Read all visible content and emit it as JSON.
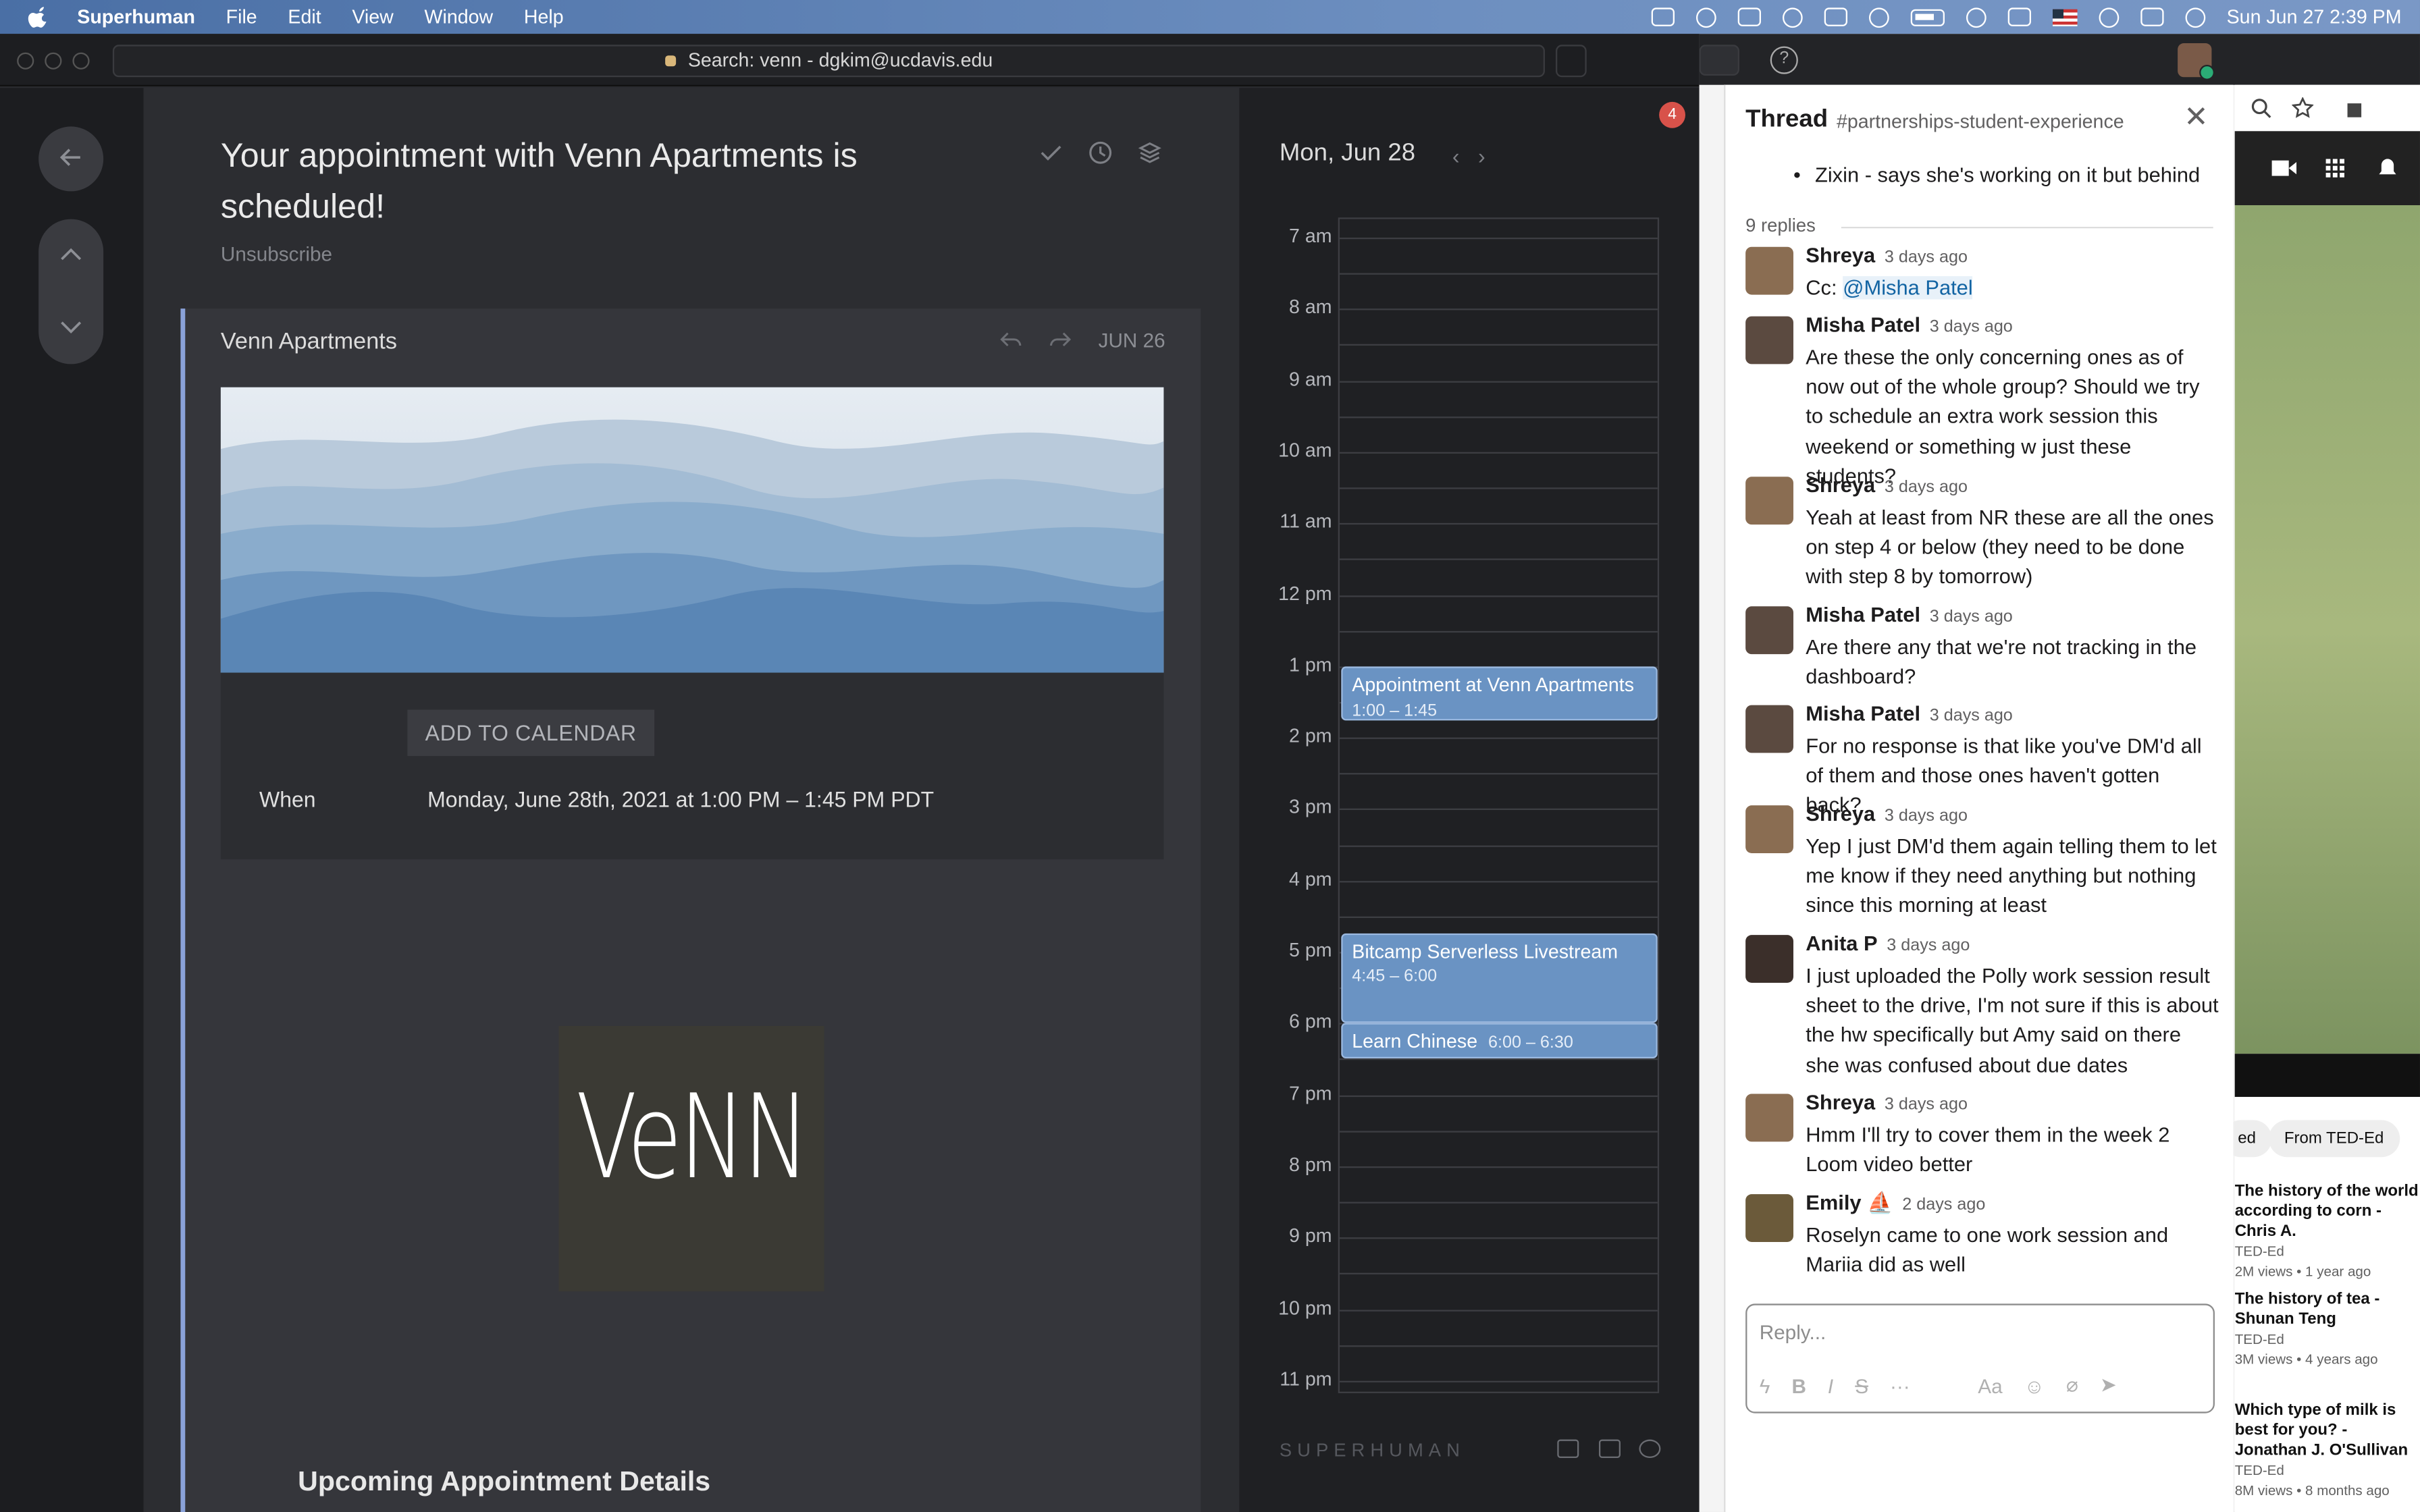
{
  "menubar": {
    "app": "Superhuman",
    "items": [
      "File",
      "Edit",
      "View",
      "Window",
      "Help"
    ],
    "clock": "Sun Jun 27  2:39 PM"
  },
  "window": {
    "search_text": "Search: venn - dgkim@ucdavis.edu"
  },
  "email": {
    "subject": "Your appointment with Venn Apartments is scheduled!",
    "unsubscribe": "Unsubscribe",
    "sender": "Venn Apartments",
    "date": "JUN 26",
    "add_to_calendar": "ADD TO CALENDAR",
    "when_label": "When",
    "when_value": "Monday, June 28th, 2021 at 1:00 PM – 1:45 PM PDT",
    "logo_text": "VeNN",
    "upcoming_heading": "Upcoming Appointment Details"
  },
  "calendar": {
    "badge": "4",
    "date": "Mon, Jun 28",
    "hours": [
      "7 am",
      "8 am",
      "9 am",
      "10 am",
      "11 am",
      "12 pm",
      "1 pm",
      "2 pm",
      "3 pm",
      "4 pm",
      "5 pm",
      "6 pm",
      "7 pm",
      "8 pm",
      "9 pm",
      "10 pm",
      "11 pm"
    ],
    "events": [
      {
        "title": "Appointment at Venn Apartments",
        "time": "1:00 – 1:45"
      },
      {
        "title": "Bitcamp Serverless Livestream",
        "time": "4:45 – 6:00"
      },
      {
        "title": "Learn Chinese",
        "time": "6:00 – 6:30"
      }
    ],
    "footer_brand": "SUPERHUMAN"
  },
  "thread": {
    "title": "Thread",
    "channel": "#partnerships-student-experience",
    "bullet": "Zixin - says she's working on it but behind",
    "replies_count": "9 replies",
    "messages": [
      {
        "name": "Shreya",
        "time": "3 days ago",
        "prefix": "Cc: ",
        "mention": "@Misha Patel",
        "text": "",
        "avatar": "#8a6d52"
      },
      {
        "name": "Misha Patel",
        "time": "3 days ago",
        "text": "Are these the only concerning ones as of now out of the whole group? Should we try to schedule an extra work session this weekend or something w just these students?",
        "avatar": "#5b4a40"
      },
      {
        "name": "Shreya",
        "time": "3 days ago",
        "text": "Yeah at least from NR these are all the ones on step 4 or below (they need to be done with step 8 by tomorrow)",
        "avatar": "#8a6d52"
      },
      {
        "name": "Misha Patel",
        "time": "3 days ago",
        "text": "Are there any that we're not tracking in the dashboard?",
        "avatar": "#5b4a40"
      },
      {
        "name": "Misha Patel",
        "time": "3 days ago",
        "text": "For no response is that like you've DM'd all of them and those ones haven't gotten back?",
        "avatar": "#5b4a40"
      },
      {
        "name": "Shreya",
        "time": "3 days ago",
        "text": "Yep I just DM'd them again telling them to let me know if they need anything but nothing since this morning at least",
        "avatar": "#8a6d52"
      },
      {
        "name": "Anita P",
        "time": "3 days ago",
        "text": "I just uploaded the Polly work session result sheet to the drive, I'm not sure if this is about the hw specifically but Amy said on there she was confused about due dates",
        "avatar": "#3b2f2a"
      },
      {
        "name": "Shreya",
        "time": "3 days ago",
        "text": "Hmm I'll try to cover them in the week 2 Loom video better",
        "avatar": "#8a6d52"
      },
      {
        "name": "Emily ⛵",
        "time": "2 days ago",
        "text": "Roselyn came to one work session and Mariia did as well",
        "avatar": "#6b5a3a"
      }
    ],
    "reply_placeholder": "Reply..."
  },
  "youtube": {
    "chips": [
      "ed",
      "From TED-Ed"
    ],
    "items": [
      {
        "title": "The history of the world according to corn - Chris A.",
        "channel": "TED-Ed",
        "meta": "2M views • 1 year ago"
      },
      {
        "title": "The history of tea - Shunan Teng",
        "channel": "TED-Ed",
        "meta": "3M views • 4 years ago"
      },
      {
        "title": "Which type of milk is best for you? - Jonathan J. O'Sullivan",
        "channel": "TED-Ed",
        "meta": "8M views • 8 months ago"
      }
    ]
  }
}
